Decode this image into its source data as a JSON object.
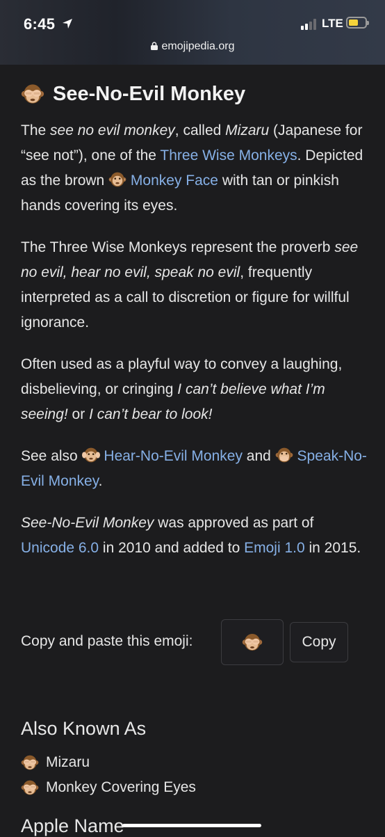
{
  "status": {
    "time": "6:45",
    "network": "LTE"
  },
  "browser": {
    "url": "emojipedia.org"
  },
  "article": {
    "title": "See-No-Evil Monkey",
    "p1": {
      "t1": "The ",
      "i1": "see no evil monkey",
      "t2": ", called ",
      "i2": "Mizaru",
      "t3": " (Japanese for “see not”), one of the ",
      "link1": "Three Wise Monkeys",
      "t4": ". Depicted as the brown ",
      "link2": "Monkey Face",
      "t5": " with tan or pinkish hands covering its eyes."
    },
    "p2": {
      "t1": "The Three Wise Monkeys represent the proverb ",
      "i1": "see no evil, hear no evil, speak no evil",
      "t2": ", frequently interpreted as a call to discretion or figure for willful ignorance."
    },
    "p3": {
      "t1": "Often used as a playful way to convey a laughing, disbelieving, or cringing ",
      "i1": "I can’t believe what I’m seeing!",
      "t2": " or ",
      "i2": "I can’t bear to look!"
    },
    "p4": {
      "t1": "See also ",
      "link1": "Hear-No-Evil Monkey",
      "t2": " and ",
      "link2": "Speak-No-Evil Monkey",
      "t3": "."
    },
    "p5": {
      "i1": "See-No-Evil Monkey",
      "t1": " was approved as part of ",
      "link1": "Unicode 6.0",
      "t2": " in 2010 and added to ",
      "link2": "Emoji 1.0",
      "t3": " in 2015."
    },
    "copy": {
      "label": "Copy and paste this emoji:",
      "button": "Copy"
    },
    "also_known_as": {
      "heading": "Also Known As",
      "items": [
        "Mizaru",
        "Monkey Covering Eyes"
      ]
    },
    "apple_name_heading": "Apple Name"
  },
  "colors": {
    "background": "#1c1c1e",
    "link": "#86b0e6",
    "text": "#e6e6e6"
  },
  "icons": [
    "location-arrow-icon",
    "signal-icon",
    "battery-icon",
    "lock-icon",
    "see-no-evil-monkey-emoji",
    "hear-no-evil-monkey-emoji",
    "speak-no-evil-monkey-emoji",
    "monkey-face-emoji"
  ]
}
